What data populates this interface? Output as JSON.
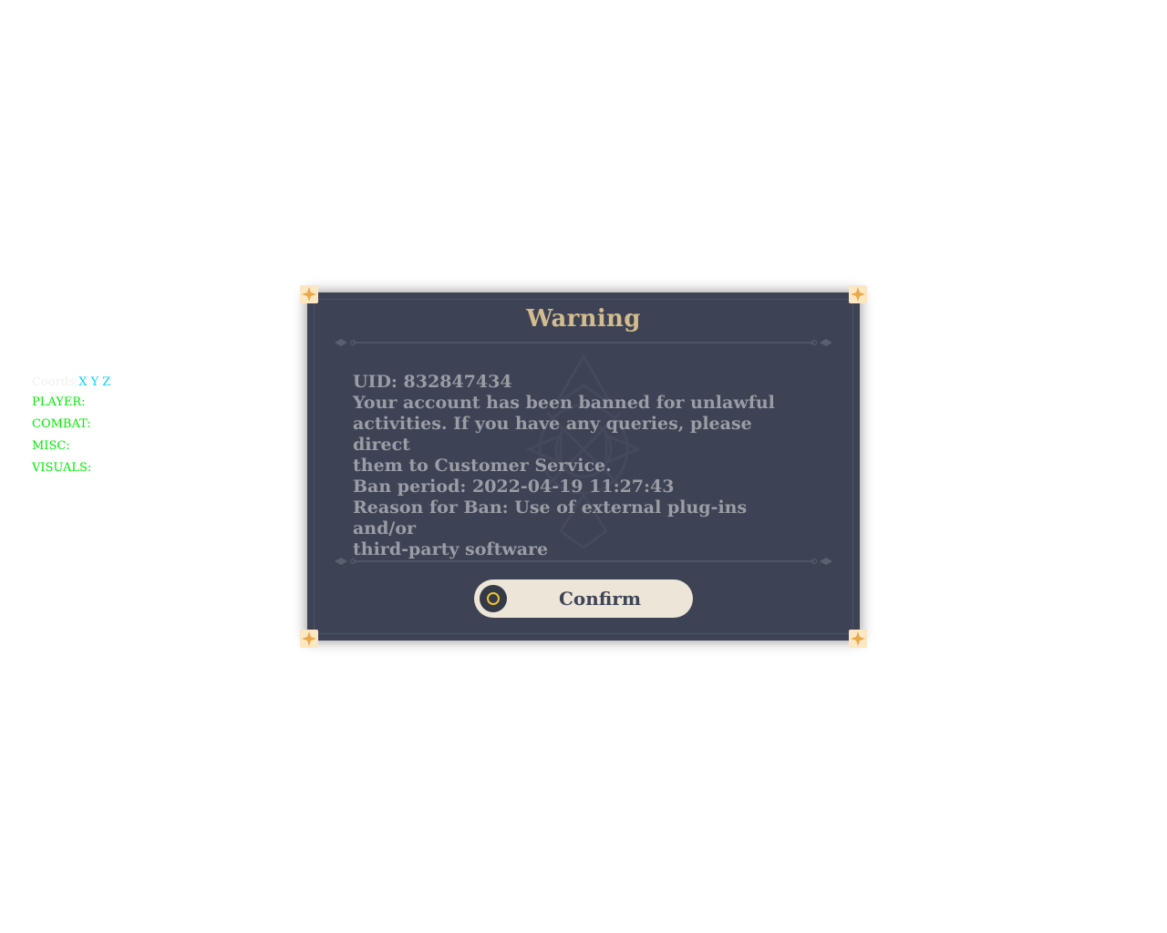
{
  "overlay": {
    "coords_prefix": "Coords:",
    "coords_axes": "X Y Z",
    "menu": [
      {
        "label": "PLAYER:"
      },
      {
        "label": "COMBAT:"
      },
      {
        "label": "MISC:"
      },
      {
        "label": "VISUALS:"
      }
    ],
    "colors": {
      "menu_text": "#00ee00",
      "axes_text": "#00d5ff"
    }
  },
  "dialog": {
    "title": "Warning",
    "message_lines": [
      "UID: 832847434",
      "Your account has been banned for unlawful",
      "activities. If you have any queries, please direct",
      "them to Customer Service.",
      "Ban period: 2022-04-19 11:27:43",
      "Reason for Ban: Use of external plug-ins and/or",
      "third-party software"
    ],
    "confirm_label": "Confirm",
    "confirm_icon": "circle-button-icon",
    "colors": {
      "panel": "#3d4354",
      "title": "#d3bc8e",
      "message": "#9a9da5",
      "button": "#ece5d8",
      "button_icon_ring": "#f2c230"
    }
  }
}
